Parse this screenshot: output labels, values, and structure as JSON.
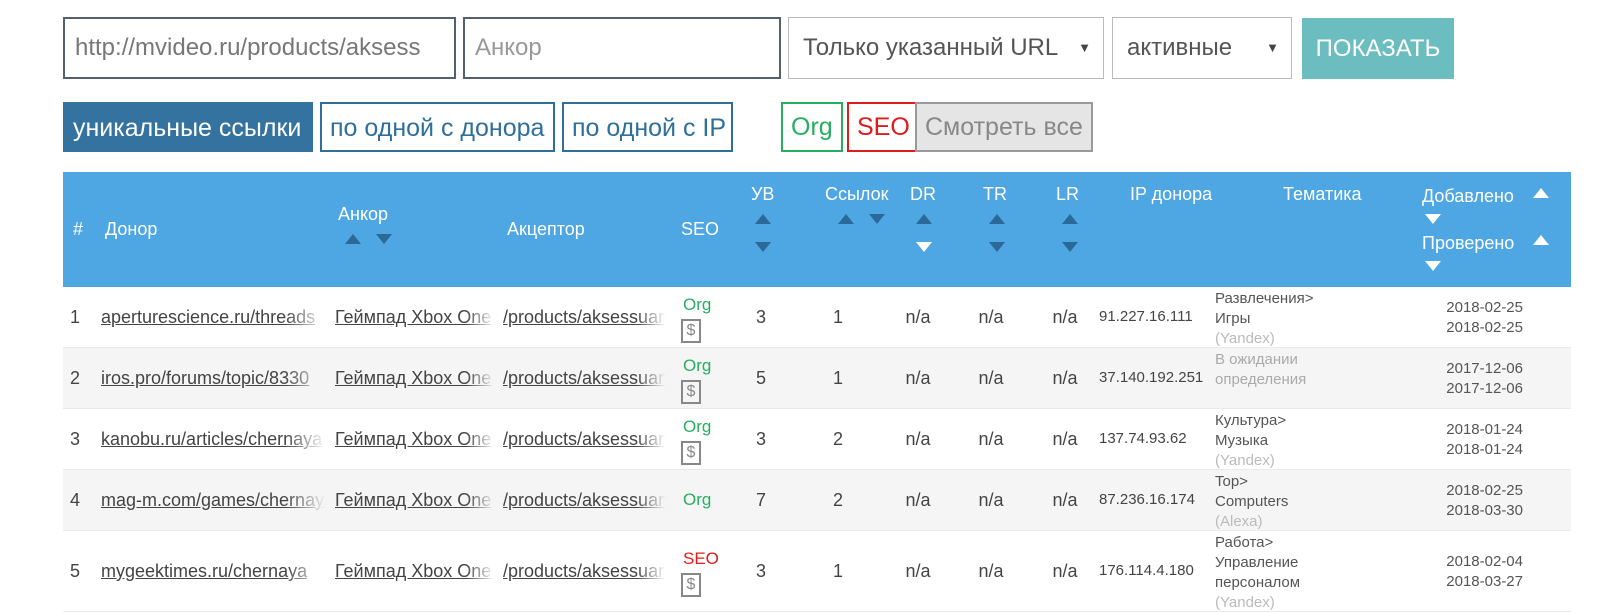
{
  "filters": {
    "url_value": "http://mvideo.ru/products/aksess",
    "anchor_placeholder": "Анкор",
    "scope_select": "Только указанный URL",
    "status_select": "активные",
    "show_button": "ПОКАЗАТЬ",
    "select_arrow": "▼"
  },
  "tabs": {
    "unique": "уникальные ссылки",
    "per_donor": "по одной с донора",
    "per_ip": "по одной с IP",
    "org": "Org",
    "seo": "SEO",
    "view_all": "Смотреть все"
  },
  "header": {
    "num": "#",
    "donor": "Донор",
    "anchor": "Анкор",
    "acceptor": "Акцептор",
    "seo": "SEO",
    "uv": "УВ",
    "links": "Ссылок",
    "dr": "DR",
    "tr": "TR",
    "lr": "LR",
    "ip": "IP донора",
    "topic": "Тематика",
    "added": "Добавлено",
    "checked": "Проверено"
  },
  "rows": [
    {
      "num": "1",
      "donor": "aperturescience.ru/threads",
      "anchor": "Геймпад Xbox One",
      "acceptor": "/products/aksessuary",
      "label": "Org",
      "label_type": "org",
      "paid": true,
      "dollar": "$",
      "uv": "3",
      "links": "1",
      "dr": "n/a",
      "tr": "n/a",
      "lr": "n/a",
      "ip": "91.227.16.111",
      "topic_line1": "Развлечения>",
      "topic_line2": "Игры",
      "topic_line3": "",
      "topic_source": "(Yandex)",
      "added": "2018-02-25",
      "checked": "2018-02-25"
    },
    {
      "num": "2",
      "donor": "iros.pro/forums/topic/8330",
      "anchor": "Геймпад Xbox One",
      "acceptor": "/products/aksessuary",
      "label": "Org",
      "label_type": "org",
      "paid": true,
      "dollar": "$",
      "uv": "5",
      "links": "1",
      "dr": "n/a",
      "tr": "n/a",
      "lr": "n/a",
      "ip": "37.140.192.251",
      "topic_line1": "В ожидании",
      "topic_line2": "определения",
      "topic_line3": "",
      "topic_source": "",
      "added": "2017-12-06",
      "checked": "2017-12-06"
    },
    {
      "num": "3",
      "donor": "kanobu.ru/articles/chernaya",
      "anchor": "Геймпад Xbox One",
      "acceptor": "/products/aksessuary",
      "label": "Org",
      "label_type": "org",
      "paid": true,
      "dollar": "$",
      "uv": "3",
      "links": "2",
      "dr": "n/a",
      "tr": "n/a",
      "lr": "n/a",
      "ip": "137.74.93.62",
      "topic_line1": "Культура>",
      "topic_line2": "Музыка",
      "topic_line3": "",
      "topic_source": "(Yandex)",
      "added": "2018-01-24",
      "checked": "2018-01-24"
    },
    {
      "num": "4",
      "donor": "mag-m.com/games/chernaya",
      "anchor": "Геймпад Xbox One",
      "acceptor": "/products/aksessuary",
      "label": "Org",
      "label_type": "org",
      "paid": false,
      "dollar": "",
      "uv": "7",
      "links": "2",
      "dr": "n/a",
      "tr": "n/a",
      "lr": "n/a",
      "ip": "87.236.16.174",
      "topic_line1": "Top>",
      "topic_line2": "Computers",
      "topic_line3": "",
      "topic_source": "(Alexa)",
      "added": "2018-02-25",
      "checked": "2018-03-30"
    },
    {
      "num": "5",
      "donor": "mygeektimes.ru/chernaya",
      "anchor": "Геймпад Xbox One",
      "acceptor": "/products/aksessuary",
      "label": "SEO",
      "label_type": "seo",
      "paid": true,
      "dollar": "$",
      "uv": "3",
      "links": "1",
      "dr": "n/a",
      "tr": "n/a",
      "lr": "n/a",
      "ip": "176.114.4.180",
      "topic_line1": "Работа>",
      "topic_line2": "Управление",
      "topic_line3": "персоналом",
      "topic_source": "(Yandex)",
      "added": "2018-02-04",
      "checked": "2018-03-27"
    }
  ]
}
